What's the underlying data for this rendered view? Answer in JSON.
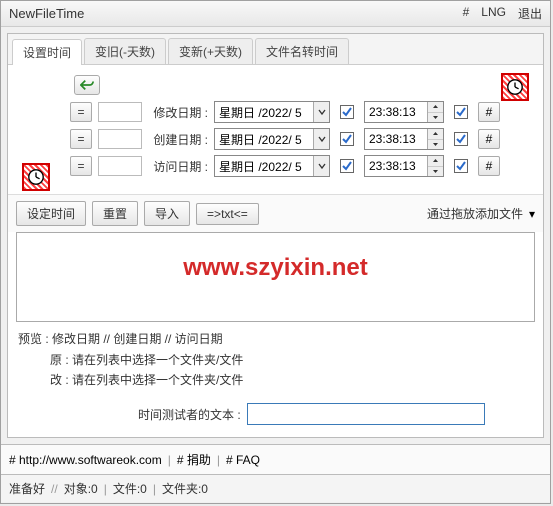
{
  "title": "NewFileTime",
  "titlebar_right": {
    "hash": "#",
    "lng": "LNG",
    "exit": "退出"
  },
  "tabs": [
    "设置时间",
    "变旧(-天数)",
    "变新(+天数)",
    "文件名转时间"
  ],
  "rows": {
    "eq": "=",
    "hash": "#",
    "labels": {
      "modify": "修改日期 :",
      "create": "创建日期 :",
      "access": "访问日期 :"
    },
    "date": "星期日 /2022/ 5",
    "time": "23:38:13"
  },
  "toolbar2": {
    "set_time": "设定时间",
    "reset": "重置",
    "import": "导入",
    "txt": "=>txt<=",
    "drag": "通过拖放添加文件",
    "drop": "▾"
  },
  "watermark": "www.szyixin.net",
  "preview": {
    "header": "预览 :   修改日期   //   创建日期   //   访问日期",
    "orig": "原 : 请在列表中选择一个文件夹/文件",
    "mod": "改 : 请在列表中选择一个文件夹/文件"
  },
  "tester": {
    "label": "时间测试者的文本 :",
    "value": ""
  },
  "footer": {
    "url": "# http://www.softwareok.com",
    "donate": "# 捐助",
    "faq": "# FAQ",
    "sep": "|"
  },
  "status": {
    "ready": "准备好",
    "sep": "//",
    "obj": "对象:0",
    "pipe": "|",
    "files": "文件:0",
    "folders": "文件夹:0"
  }
}
